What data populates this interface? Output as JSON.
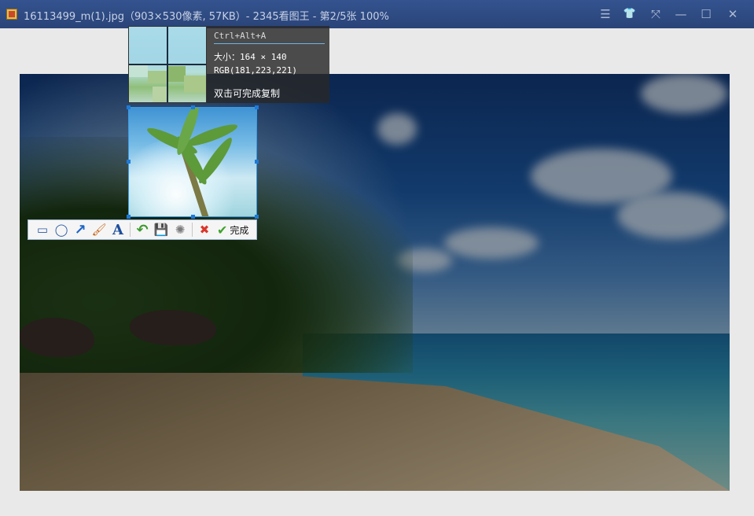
{
  "window": {
    "title": "16113499_m(1).jpg（903×530像素, 57KB）- 2345看图王 - 第2/5张 100%",
    "controls": {
      "menu": "☰",
      "skin": "👕",
      "fullscreen": "⤧",
      "minimize": "—",
      "maximize": "☐",
      "close": "✕"
    }
  },
  "capture_info": {
    "shortcut": "Ctrl+Alt+A",
    "size_text": "大小：164 × 140",
    "rgb_text": "RGB(181,223,221)",
    "hint": "双击可完成复制"
  },
  "toolbar": {
    "tools": [
      {
        "name": "rectangle-tool",
        "glyph": "▭"
      },
      {
        "name": "ellipse-tool",
        "glyph": "◯"
      },
      {
        "name": "arrow-tool",
        "glyph": "↗"
      },
      {
        "name": "brush-tool",
        "glyph": "🖌"
      },
      {
        "name": "text-tool",
        "glyph": "A"
      }
    ],
    "actions": [
      {
        "name": "undo-button",
        "glyph": "↶"
      },
      {
        "name": "save-button",
        "glyph": "💾"
      },
      {
        "name": "mosaic-button",
        "glyph": "✺"
      }
    ],
    "cancel_glyph": "✖",
    "done_glyph": "✔",
    "done_label": "完成"
  },
  "colors": {
    "titlebar": "#2f4b84",
    "selection_border": "#3a9be6",
    "info_underline": "#6fb3e8",
    "done_check": "#3fa32c",
    "cancel_x": "#d9362b"
  }
}
